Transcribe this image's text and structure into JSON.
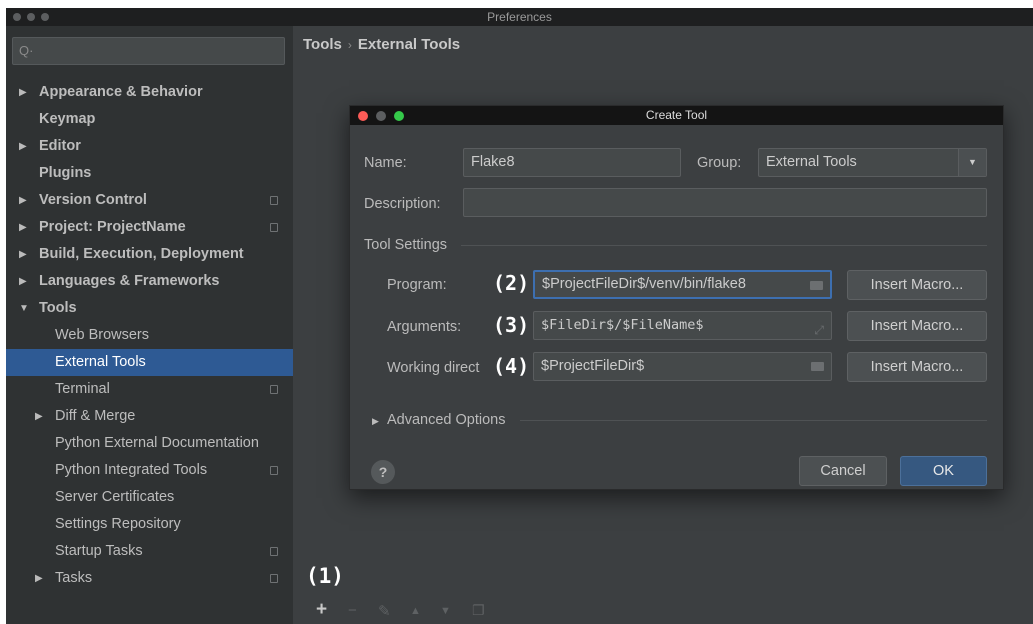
{
  "window": {
    "title": "Preferences"
  },
  "breadcrumb": {
    "parent": "Tools",
    "separator": "›",
    "current": "External Tools"
  },
  "sidebar": {
    "items": [
      {
        "label": "Appearance & Behavior",
        "bold": true,
        "arrow": "▶"
      },
      {
        "label": "Keymap",
        "bold": true,
        "arrow": ""
      },
      {
        "label": "Editor",
        "bold": true,
        "arrow": "▶"
      },
      {
        "label": "Plugins",
        "bold": true,
        "arrow": ""
      },
      {
        "label": "Version Control",
        "bold": true,
        "arrow": "▶",
        "copy": true
      },
      {
        "label": "Project: ProjectName",
        "bold": true,
        "arrow": "▶",
        "copy": true
      },
      {
        "label": "Build, Execution, Deployment",
        "bold": true,
        "arrow": "▶"
      },
      {
        "label": "Languages & Frameworks",
        "bold": true,
        "arrow": "▶"
      },
      {
        "label": "Tools",
        "bold": true,
        "arrow": "▼"
      },
      {
        "label": "Web Browsers",
        "bold": false,
        "arrow": ""
      },
      {
        "label": "External Tools",
        "bold": false,
        "arrow": "",
        "selected": true
      },
      {
        "label": "Terminal",
        "bold": false,
        "arrow": "",
        "copy": true
      },
      {
        "label": "Diff & Merge",
        "bold": false,
        "arrow": "▶"
      },
      {
        "label": "Python External Documentation",
        "bold": false,
        "arrow": ""
      },
      {
        "label": "Python Integrated Tools",
        "bold": false,
        "arrow": "",
        "copy": true
      },
      {
        "label": "Server Certificates",
        "bold": false,
        "arrow": ""
      },
      {
        "label": "Settings Repository",
        "bold": false,
        "arrow": ""
      },
      {
        "label": "Startup Tasks",
        "bold": false,
        "arrow": "",
        "copy": true
      },
      {
        "label": "Tasks",
        "bold": false,
        "arrow": "▶",
        "copy": true
      }
    ]
  },
  "dialog": {
    "title": "Create Tool",
    "name_label": "Name:",
    "name_value": "Flake8",
    "group_label": "Group:",
    "group_value": "External Tools",
    "description_label": "Description:",
    "description_value": "",
    "tool_settings_label": "Tool Settings",
    "program_label": "Program:",
    "program_value": "$ProjectFileDir$/venv/bin/flake8",
    "arguments_label": "Arguments:",
    "arguments_value": "$FileDir$/$FileName$",
    "working_dir_label": "Working direct",
    "working_dir_value": "$ProjectFileDir$",
    "insert_macro_label": "Insert Macro...",
    "advanced_options_label": "Advanced Options",
    "cancel_label": "Cancel",
    "ok_label": "OK",
    "help_label": "?"
  },
  "annotations": {
    "a1": "(1)",
    "a2": "(2)",
    "a3": "(3)",
    "a4": "(4)"
  },
  "colors": {
    "accent": "#2e5a94",
    "ok_button": "#365880",
    "background": "#3c3f41"
  }
}
